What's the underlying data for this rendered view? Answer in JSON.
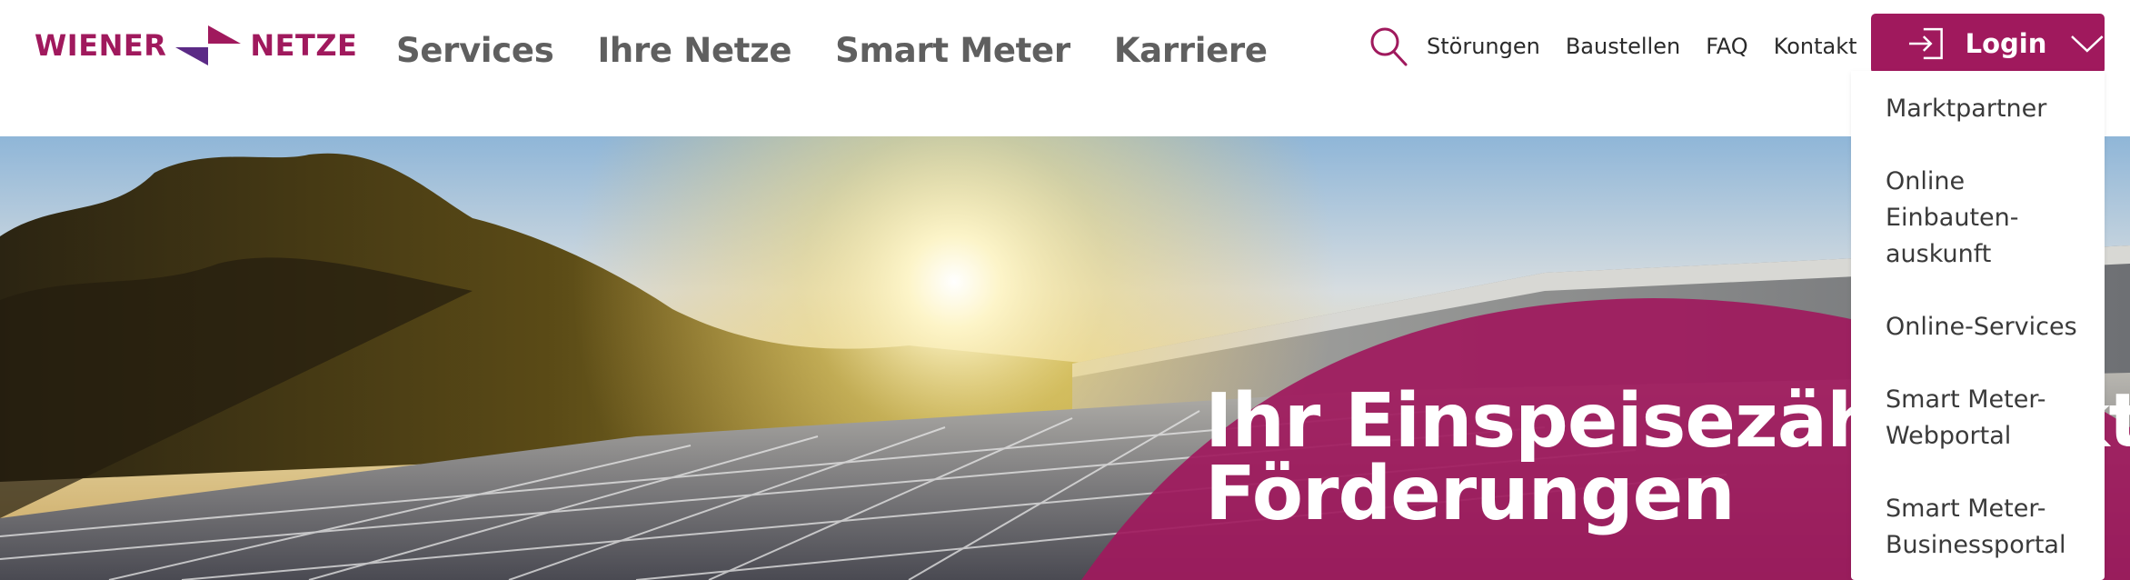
{
  "brand": {
    "left_word": "WIENER",
    "right_word": "NETZE",
    "logo_icon": "wiener-netze-arrows-logo",
    "color": "#a0195d"
  },
  "main_nav": [
    "Services",
    "Ihre Netze",
    "Smart Meter",
    "Karriere"
  ],
  "util_nav": {
    "search_icon": "search-icon",
    "links": [
      "Störungen",
      "Baustellen",
      "FAQ",
      "Kontakt"
    ]
  },
  "login": {
    "label": "Login",
    "icon": "login-arrow-icon",
    "chevron": "chevron-down-icon",
    "color": "#a0195d"
  },
  "login_menu": [
    "Marktpartner",
    "Online Einbauten-auskunft",
    "Online-Services",
    "Smart Meter-Webportal",
    "Smart Meter-Businessportal"
  ],
  "hero": {
    "title_line1": "Ihr Einspeisezählpunkt",
    "title_line2": "Förderungen",
    "accent_color": "#a0195d"
  }
}
